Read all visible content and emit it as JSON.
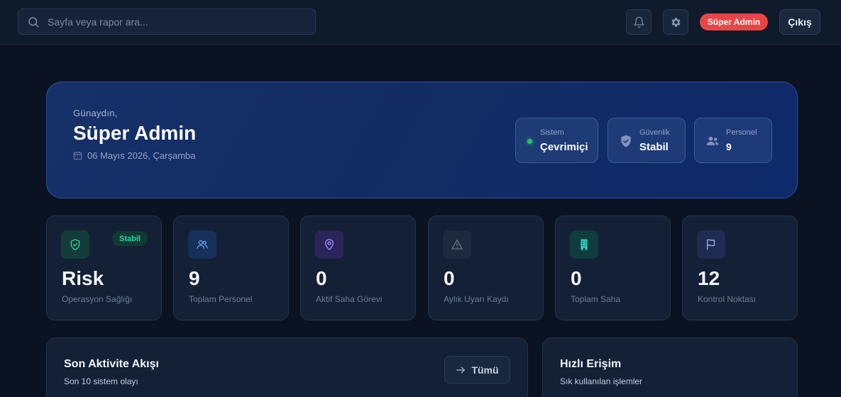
{
  "topbar": {
    "search_placeholder": "Sayfa veya rapor ara...",
    "role_badge": "Süper Admin",
    "logout_label": "Çıkış"
  },
  "hero": {
    "greeting": "Günaydın,",
    "user_name": "Süper Admin",
    "date": "06 Mayıs 2026, Çarşamba",
    "stats": [
      {
        "label": "Sistem",
        "value": "Çevrimiçi",
        "icon": "status-dot"
      },
      {
        "label": "Güvenlik",
        "value": "Stabil",
        "icon": "shield-icon"
      },
      {
        "label": "Personel",
        "value": "9",
        "icon": "users-icon"
      }
    ]
  },
  "cards": [
    {
      "value": "Risk",
      "caption": "Operasyon Sağlığı",
      "icon": "shield-check-icon",
      "badge": "Stabil",
      "color": "#34d399"
    },
    {
      "value": "9",
      "caption": "Toplam Personel",
      "icon": "users-icon",
      "color": "#60a5fa"
    },
    {
      "value": "0",
      "caption": "Aktif Saha Görevi",
      "icon": "map-pin-icon",
      "color": "#a78bfa"
    },
    {
      "value": "0",
      "caption": "Aylık Uyarı Kaydı",
      "icon": "alert-triangle-icon",
      "color": "#64748b"
    },
    {
      "value": "0",
      "caption": "Toplam Saha",
      "icon": "building-icon",
      "color": "#2dd4bf"
    },
    {
      "value": "12",
      "caption": "Kontrol Noktası",
      "icon": "flag-icon",
      "color": "#a5b4fc"
    }
  ],
  "activity": {
    "title": "Son Aktivite Akışı",
    "subtitle": "Son 10 sistem olayı",
    "all_label": "Tümü"
  },
  "quick": {
    "title": "Hızlı Erişim",
    "subtitle": "Sık kullanılan işlemler"
  },
  "colors": {
    "background": "#0b1322",
    "accent_red": "#e84646",
    "online_green": "#22c55e"
  }
}
